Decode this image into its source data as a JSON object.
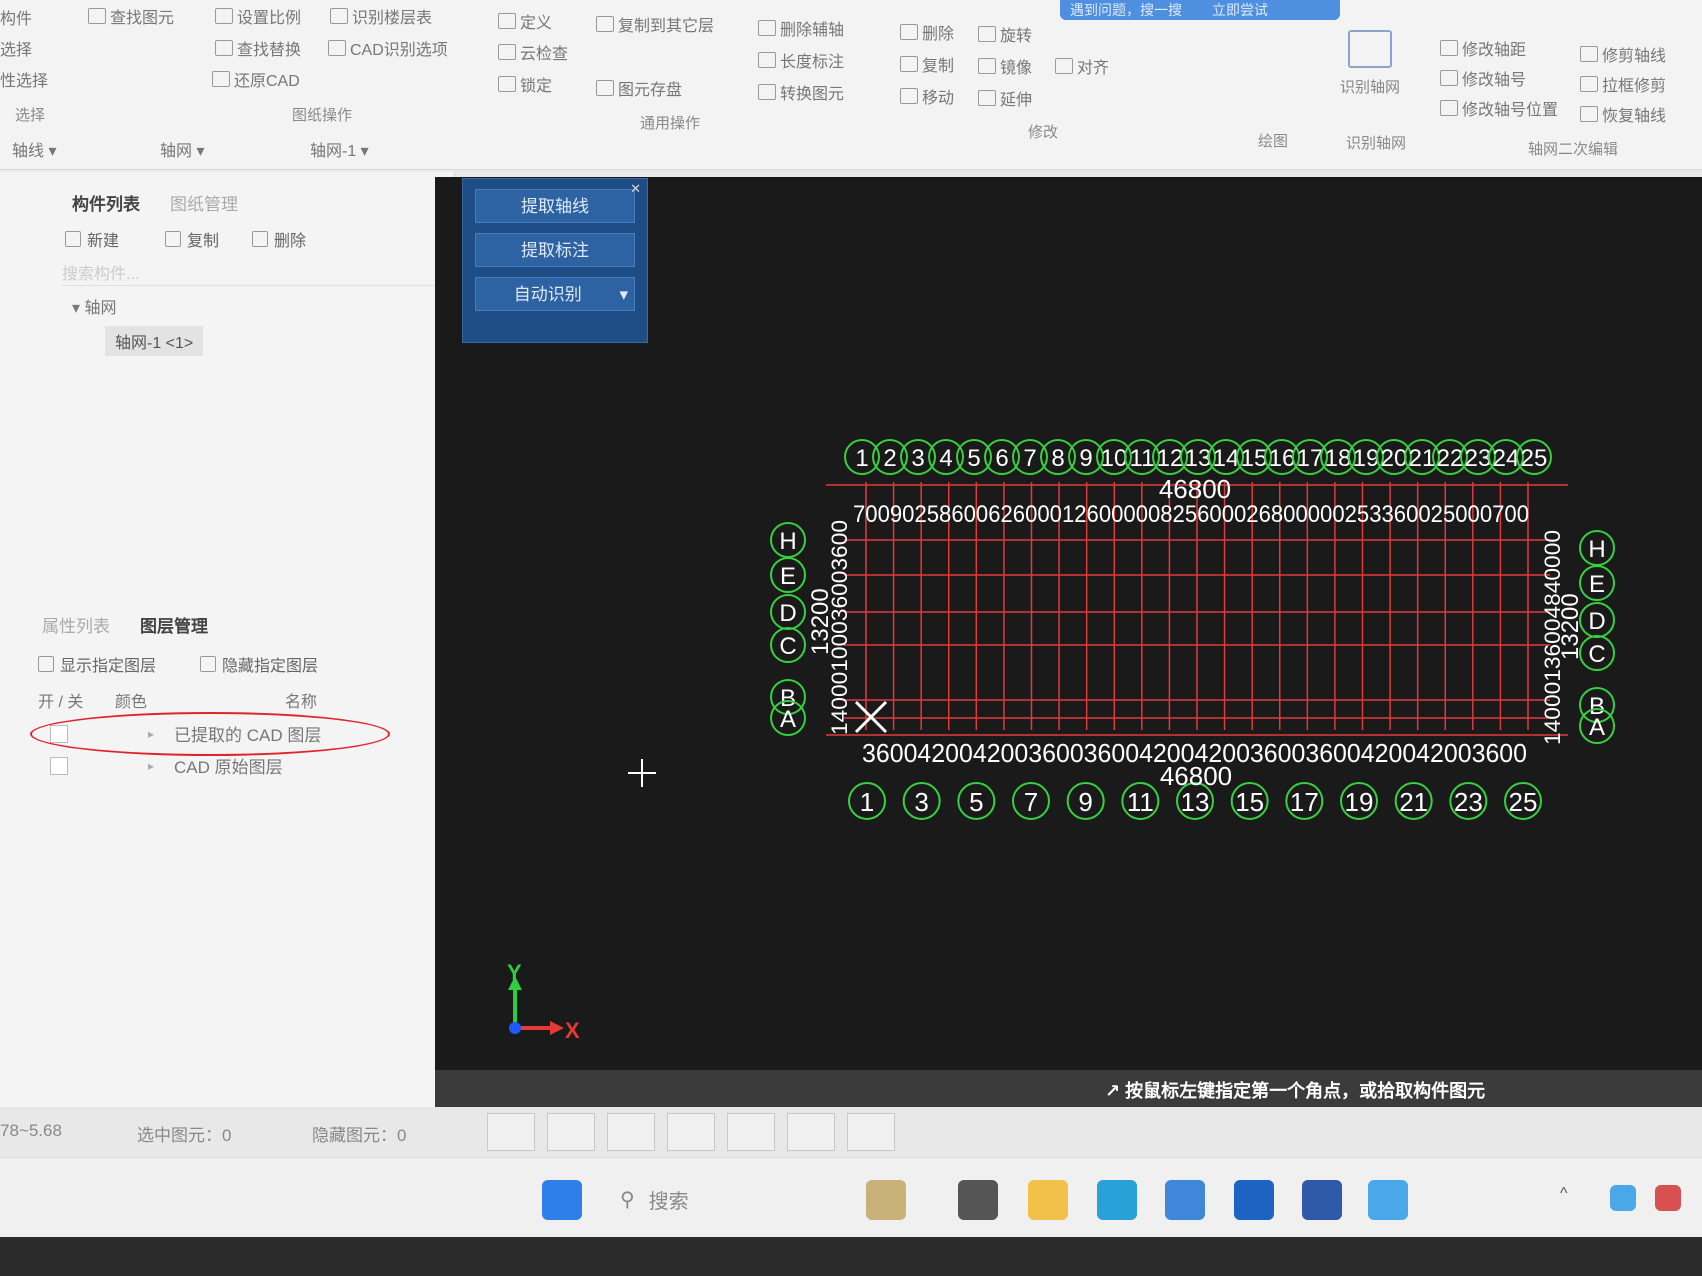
{
  "ribbon": {
    "banner": {
      "left": "遇到问题，搜一搜",
      "right": "立即尝试"
    },
    "items": [
      {
        "label": "构件"
      },
      {
        "label": "选择"
      },
      {
        "label": "性选择"
      },
      {
        "label": "查找图元"
      },
      {
        "label": "设置比例"
      },
      {
        "label": "识别楼层表"
      },
      {
        "label": "查找替换"
      },
      {
        "label": "CAD识别选项"
      },
      {
        "label": "还原CAD"
      },
      {
        "label": "定义"
      },
      {
        "label": "云检查"
      },
      {
        "label": "锁定"
      },
      {
        "label": "复制到其它层"
      },
      {
        "label": "图元存盘"
      },
      {
        "label": "删除辅轴"
      },
      {
        "label": "长度标注"
      },
      {
        "label": "转换图元"
      },
      {
        "label": "删除"
      },
      {
        "label": "复制"
      },
      {
        "label": "移动"
      },
      {
        "label": "旋转"
      },
      {
        "label": "镜像"
      },
      {
        "label": "延伸"
      },
      {
        "label": "对齐"
      },
      {
        "label": "修改轴距"
      },
      {
        "label": "修改轴号"
      },
      {
        "label": "修改轴号位置"
      },
      {
        "label": "修剪轴线"
      },
      {
        "label": "拉框修剪"
      },
      {
        "label": "恢复轴线"
      }
    ],
    "groups": {
      "select": "选择",
      "drawing_ops": "图纸操作",
      "common_ops": "通用操作",
      "modify": "修改",
      "draw": "绘图",
      "identify_grid": "识别轴网",
      "grid_edit": "轴网二次编辑"
    },
    "big_button": "识别轴网",
    "selectors": {
      "type": "轴线",
      "sub": "轴网",
      "instance": "轴网-1"
    }
  },
  "left_panel": {
    "tabs_top": [
      "构件列表",
      "图纸管理"
    ],
    "tools": {
      "new": "新建",
      "copy": "复制",
      "delete": "删除"
    },
    "search_placeholder": "搜索构件...",
    "tree_root": "轴网",
    "tree_leaf": "轴网-1 <1>",
    "tabs_bottom": [
      "属性列表",
      "图层管理"
    ],
    "layer_tools": {
      "show": "显示指定图层",
      "hide": "隐藏指定图层"
    },
    "layer_headers": {
      "onoff": "开 / 关",
      "color": "颜色",
      "name": "名称"
    },
    "layers": [
      {
        "name": "已提取的 CAD 图层",
        "highlighted": true
      },
      {
        "name": "CAD 原始图层",
        "highlighted": false
      }
    ]
  },
  "floating_panel": {
    "buttons": [
      "提取轴线",
      "提取标注",
      "自动识别"
    ]
  },
  "drawing": {
    "top_numbers": [
      "1",
      "2",
      "3",
      "4",
      "5",
      "6",
      "7",
      "8",
      "9",
      "10",
      "11",
      "12",
      "13",
      "14",
      "15",
      "16",
      "17",
      "18",
      "19",
      "20",
      "21",
      "22",
      "23",
      "24",
      "25"
    ],
    "top_total": "46800",
    "top_dims": "7009025860062600012600000825600026800000253360025000700",
    "bottom_numbers": [
      "1",
      "3",
      "5",
      "7",
      "9",
      "11",
      "13",
      "15",
      "17",
      "19",
      "21",
      "23",
      "25"
    ],
    "bottom_dims": [
      "3600",
      "4200",
      "4200",
      "3600",
      "3600",
      "4200",
      "4200",
      "3600",
      "3600",
      "4200",
      "4200",
      "3600"
    ],
    "bottom_total": "46800",
    "left_letters": [
      "H",
      "E",
      "D",
      "C",
      "B",
      "A"
    ],
    "right_letters": [
      "H",
      "E",
      "D",
      "C",
      "B",
      "A"
    ],
    "side_total": "13200",
    "side_dims_left": "14000100036003600",
    "side_dims_right": "14000136004840000",
    "axis_x": "X",
    "axis_y": "Y"
  },
  "hint": "按鼠标左键指定第一个角点，或拾取构件图元",
  "statusbar": {
    "coords": "78~5.68",
    "selected": "选中图元：0",
    "hidden": "隐藏图元：0"
  },
  "taskbar": {
    "search": "搜索"
  }
}
